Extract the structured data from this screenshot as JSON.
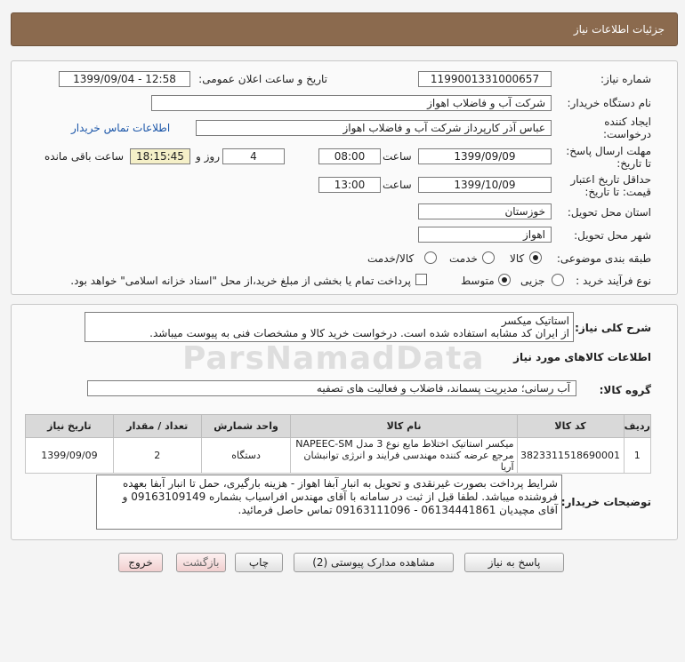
{
  "header": {
    "title": "جزئیات اطلاعات نیاز"
  },
  "info": {
    "need_number_label": "شماره نیاز:",
    "need_number": "1199001331000657",
    "announce_label": "تاریخ و ساعت اعلان عمومی:",
    "announce_value": "1399/09/04 - 12:58",
    "buyer_org_label": "نام دستگاه خریدار:",
    "buyer_org": "شرکت آب و فاضلاب اهواز",
    "creator_label_1": "ایجاد کننده",
    "creator_label_2": "درخواست:",
    "creator": "عباس آذر کارپرداز شرکت آب و فاضلاب اهواز",
    "contact_link": "اطلاعات تماس خریدار",
    "reply_deadline_label_1": "مهلت ارسال پاسخ:",
    "reply_deadline_label_2": "تا تاریخ:",
    "reply_date": "1399/09/09",
    "time_label": "ساعت",
    "reply_time": "08:00",
    "days": "4",
    "days_label": "روز و",
    "remaining": "18:15:45",
    "remaining_label": "ساعت باقی مانده",
    "validity_label_1": "حداقل تاریخ اعتبار",
    "validity_label_2": "قیمت: تا تاریخ:",
    "validity_date": "1399/10/09",
    "validity_time_label": "ساعت",
    "validity_time": "13:00",
    "province_label": "استان محل تحویل:",
    "province": "خوزستان",
    "city_label": "شهر محل تحویل:",
    "city": "اهواز",
    "category_label": "طبقه بندی موضوعی:",
    "category_options": [
      "کالا",
      "خدمت",
      "کالا/خدمت"
    ],
    "purchase_type_label": "نوع فرآیند خرید :",
    "purchase_options": [
      "جزیی",
      "متوسط"
    ],
    "payment_note": "پرداخت تمام یا بخشی از مبلغ خرید،از محل \"اسناد خزانه اسلامی\" خواهد بود."
  },
  "need": {
    "summary_label": "شرح کلی نیاز:",
    "summary_line1": "استاتیک میکسر",
    "summary_line2": "از ایران کد مشابه استفاده شده است. درخواست خرید کالا و مشخصات فنی به پیوست میباشد.",
    "goods_info_title": "اطلاعات کالاهای مورد نیاز",
    "goods_group_label": "گروه کالا:",
    "goods_group": "آب رسانی؛ مدیریت پسماند، فاضلاب و فعالیت های تصفیه",
    "table": {
      "headers": [
        "ردیف",
        "کد کالا",
        "نام کالا",
        "واحد شمارش",
        "تعداد / مقدار",
        "تاریخ نیاز"
      ],
      "rows": [
        {
          "row": "1",
          "code": "3823311518690001",
          "name": "میکسر استاتیک اختلاط مایع نوع 3 مدل NAPEEC-SM مرجع عرضه کننده مهندسی فرایند و انرژی توانبشان آریا",
          "unit": "دستگاه",
          "qty": "2",
          "date": "1399/09/09"
        }
      ]
    },
    "buyer_notes_label": "توضیحات خریدار:",
    "buyer_notes": "شرایط پرداخت بصورت غیرنقدی و تحویل به انبار آبفا اهواز - هزینه بارگیری، حمل تا انبار آبفا بعهده فروشنده میباشد. لطفا قبل از ثبت در سامانه با آقای مهندس افراسیاب  بشماره 09163109149 و آقای مچیدیان 06134441861 -  09163111096 تماس حاصل فرمائید."
  },
  "buttons": {
    "reply": "پاسخ به نیاز",
    "attachments": "مشاهده مدارک پیوستی (2)",
    "print": "چاپ",
    "back": "بازگشت",
    "exit": "خروج"
  },
  "watermark": {
    "text": "ParsNamadData"
  },
  "colors": {
    "header_bg": "#8b6a4e",
    "link": "#1a55a8",
    "timer_bg": "#f5f0c8"
  }
}
